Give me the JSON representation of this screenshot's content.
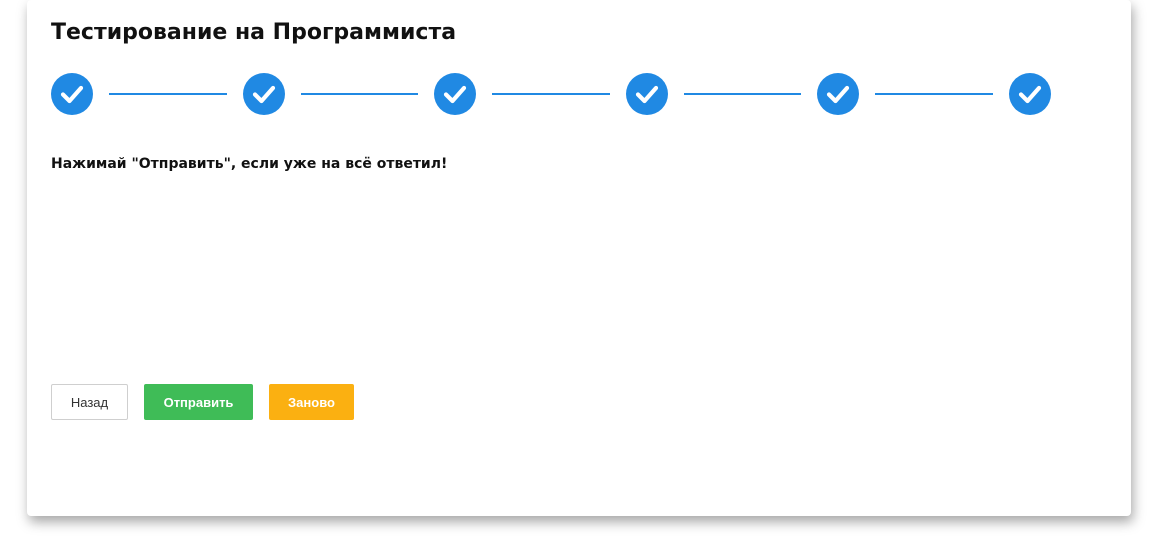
{
  "page": {
    "title": "Тестирование на Программиста",
    "message": "Нажимай \"Отправить\", если уже на всё ответил!"
  },
  "stepper": {
    "steps": [
      {
        "status": "completed",
        "icon": "checkmark-icon"
      },
      {
        "status": "completed",
        "icon": "checkmark-icon"
      },
      {
        "status": "completed",
        "icon": "checkmark-icon"
      },
      {
        "status": "completed",
        "icon": "checkmark-icon"
      },
      {
        "status": "completed",
        "icon": "checkmark-icon"
      },
      {
        "status": "completed",
        "icon": "checkmark-icon"
      }
    ],
    "color": "#2089e3"
  },
  "buttons": {
    "back_label": "Назад",
    "submit_label": "Отправить",
    "restart_label": "Заново"
  },
  "colors": {
    "accent": "#2089e3",
    "submit": "#3fbc57",
    "restart": "#fbb011"
  }
}
